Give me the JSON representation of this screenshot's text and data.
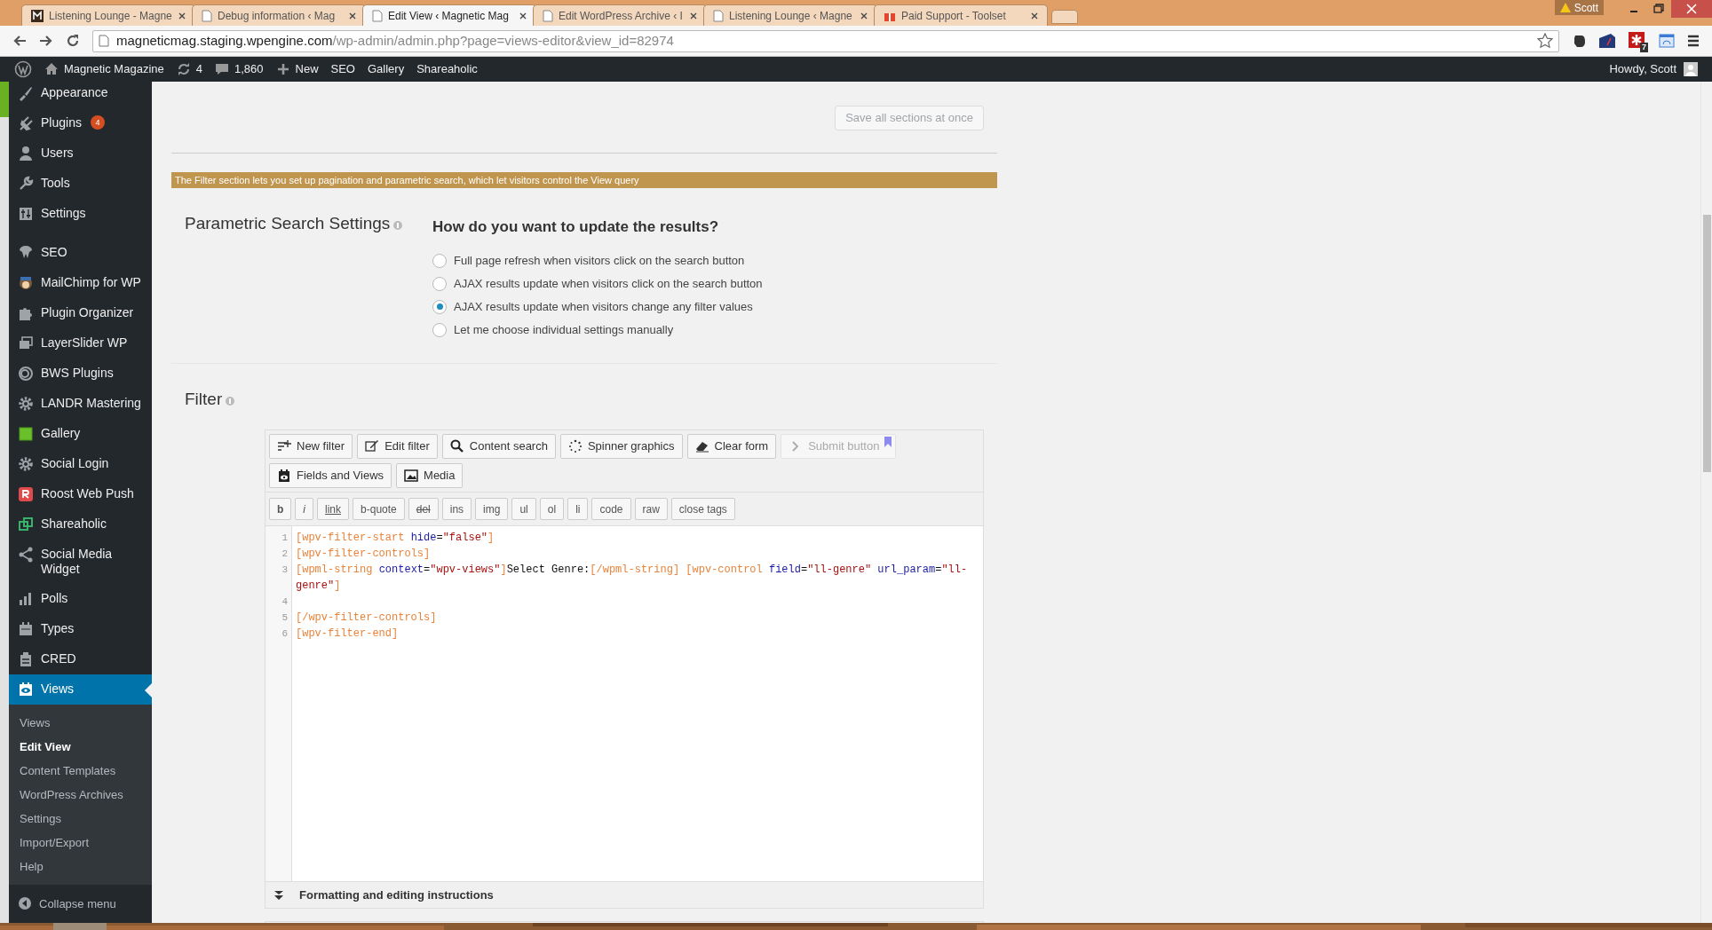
{
  "browser": {
    "tabs": [
      {
        "title": "Listening Lounge - Magne",
        "selected": false,
        "kind": "site"
      },
      {
        "title": "Debug information ‹ Mag",
        "selected": false,
        "kind": "page"
      },
      {
        "title": "Edit View ‹ Magnetic Mag",
        "selected": true,
        "kind": "page"
      },
      {
        "title": "Edit WordPress Archive ‹ I",
        "selected": false,
        "kind": "page"
      },
      {
        "title": "Listening Lounge ‹ Magne",
        "selected": false,
        "kind": "page"
      },
      {
        "title": "Paid Support - Toolset",
        "selected": false,
        "kind": "support"
      }
    ],
    "profile": "Scott",
    "url_host": "magneticmag.staging.wpengine.com",
    "url_path": "/wp-admin/admin.php?page=views-editor&view_id=82974",
    "extension_badge": "7"
  },
  "admin_bar": {
    "items": [
      {
        "kind": "site",
        "label": "Magnetic Magazine"
      },
      {
        "kind": "updates",
        "label": "4"
      },
      {
        "kind": "comments",
        "label": "1,860"
      },
      {
        "kind": "new",
        "label": "New"
      },
      {
        "kind": "plain",
        "label": "SEO"
      },
      {
        "kind": "plain",
        "label": "Gallery"
      },
      {
        "kind": "plain",
        "label": "Shareaholic"
      }
    ],
    "greeting": "Howdy, Scott"
  },
  "sidebar": {
    "items": [
      {
        "label": "Appearance",
        "current": false
      },
      {
        "label": "Plugins",
        "badge": "4",
        "current": false
      },
      {
        "label": "Users",
        "current": false
      },
      {
        "label": "Tools",
        "current": false
      },
      {
        "label": "Settings",
        "current": false
      },
      {
        "label": "SEO",
        "current": false
      },
      {
        "label": "MailChimp for WP",
        "current": false
      },
      {
        "label": "Plugin Organizer",
        "current": false
      },
      {
        "label": "LayerSlider WP",
        "current": false
      },
      {
        "label": "BWS Plugins",
        "current": false
      },
      {
        "label": "LANDR Mastering",
        "current": false
      },
      {
        "label": "Gallery",
        "current": false
      },
      {
        "label": "Social Login",
        "current": false
      },
      {
        "label": "Roost Web Push",
        "current": false
      },
      {
        "label": "Shareaholic",
        "current": false
      },
      {
        "label": "Social Media Widget",
        "current": false
      },
      {
        "label": "Polls",
        "current": false
      },
      {
        "label": "Types",
        "current": false
      },
      {
        "label": "CRED",
        "current": false
      },
      {
        "label": "Views",
        "current": true
      }
    ],
    "submenu": [
      {
        "label": "Views",
        "selected": false
      },
      {
        "label": "Edit View",
        "selected": true
      },
      {
        "label": "Content Templates",
        "selected": false
      },
      {
        "label": "WordPress Archives",
        "selected": false
      },
      {
        "label": "Settings",
        "selected": false
      },
      {
        "label": "Import/Export",
        "selected": false
      },
      {
        "label": "Help",
        "selected": false
      }
    ],
    "collapse": "Collapse menu"
  },
  "save_all": "Save all sections at once",
  "notice": "The Filter section lets you set up pagination and parametric search, which let visitors control the View query",
  "parametric": {
    "title": "Parametric Search Settings",
    "question": "How do you want to update the results?",
    "options": [
      {
        "label": "Full page refresh when visitors click on the search button",
        "selected": false
      },
      {
        "label": "AJAX results update when visitors click on the search button",
        "selected": false
      },
      {
        "label": "AJAX results update when visitors change any filter values",
        "selected": true
      },
      {
        "label": "Let me choose individual settings manually",
        "selected": false
      }
    ]
  },
  "filter": {
    "title": "Filter",
    "buttons": [
      {
        "label": "New filter",
        "disabled": false
      },
      {
        "label": "Edit filter",
        "disabled": false
      },
      {
        "label": "Content search",
        "disabled": false
      },
      {
        "label": "Spinner graphics",
        "disabled": false
      },
      {
        "label": "Clear form",
        "disabled": false
      },
      {
        "label": "Submit button",
        "disabled": true
      }
    ],
    "buttons_second_row": [
      {
        "label": "Fields and Views",
        "disabled": false
      },
      {
        "label": "Media",
        "disabled": false
      }
    ],
    "format_buttons": [
      {
        "label": "b",
        "kind": "bold"
      },
      {
        "label": "i",
        "kind": "italic"
      },
      {
        "label": "link",
        "kind": "underline"
      },
      {
        "label": "b-quote",
        "kind": "plain"
      },
      {
        "label": "del",
        "kind": "strike"
      },
      {
        "label": "ins",
        "kind": "plain"
      },
      {
        "label": "img",
        "kind": "plain"
      },
      {
        "label": "ul",
        "kind": "plain"
      },
      {
        "label": "ol",
        "kind": "plain"
      },
      {
        "label": "li",
        "kind": "plain"
      },
      {
        "label": "code",
        "kind": "plain"
      },
      {
        "label": "raw",
        "kind": "plain"
      },
      {
        "label": "close tags",
        "kind": "plain"
      }
    ],
    "code_lines": [
      {
        "number": "1",
        "tokens": [
          {
            "kind": "tag",
            "text": "[wpv-filter-start "
          },
          {
            "kind": "attr",
            "text": "hide"
          },
          {
            "kind": "text",
            "text": "="
          },
          {
            "kind": "string",
            "text": "\"false\""
          },
          {
            "kind": "tag",
            "text": "]"
          }
        ]
      },
      {
        "number": "2",
        "tokens": [
          {
            "kind": "tag",
            "text": "[wpv-filter-controls]"
          }
        ]
      },
      {
        "number": "3",
        "tokens": [
          {
            "kind": "tag",
            "text": "[wpml-string "
          },
          {
            "kind": "attr",
            "text": "context"
          },
          {
            "kind": "text",
            "text": "="
          },
          {
            "kind": "string",
            "text": "\"wpv-views\""
          },
          {
            "kind": "tag",
            "text": "]"
          },
          {
            "kind": "text",
            "text": "Select Genre:"
          },
          {
            "kind": "tag",
            "text": "[/wpml-string] [wpv-control "
          },
          {
            "kind": "attr",
            "text": "field"
          },
          {
            "kind": "text",
            "text": "="
          },
          {
            "kind": "string",
            "text": "\"ll-genre\""
          },
          {
            "kind": "attr",
            "text": " url_param"
          },
          {
            "kind": "text",
            "text": "="
          },
          {
            "kind": "string",
            "text": "\"ll-"
          }
        ]
      },
      {
        "tokens": [
          {
            "kind": "string",
            "text": "genre\""
          },
          {
            "kind": "tag",
            "text": "]"
          }
        ]
      },
      {
        "number": "4"
      },
      {
        "number": "5",
        "tokens": [
          {
            "kind": "tag",
            "text": "[/wpv-filter-controls]"
          }
        ]
      },
      {
        "number": "6",
        "tokens": [
          {
            "kind": "tag",
            "text": "[wpv-filter-end]"
          }
        ]
      }
    ],
    "instructions": "Formatting and editing instructions"
  }
}
